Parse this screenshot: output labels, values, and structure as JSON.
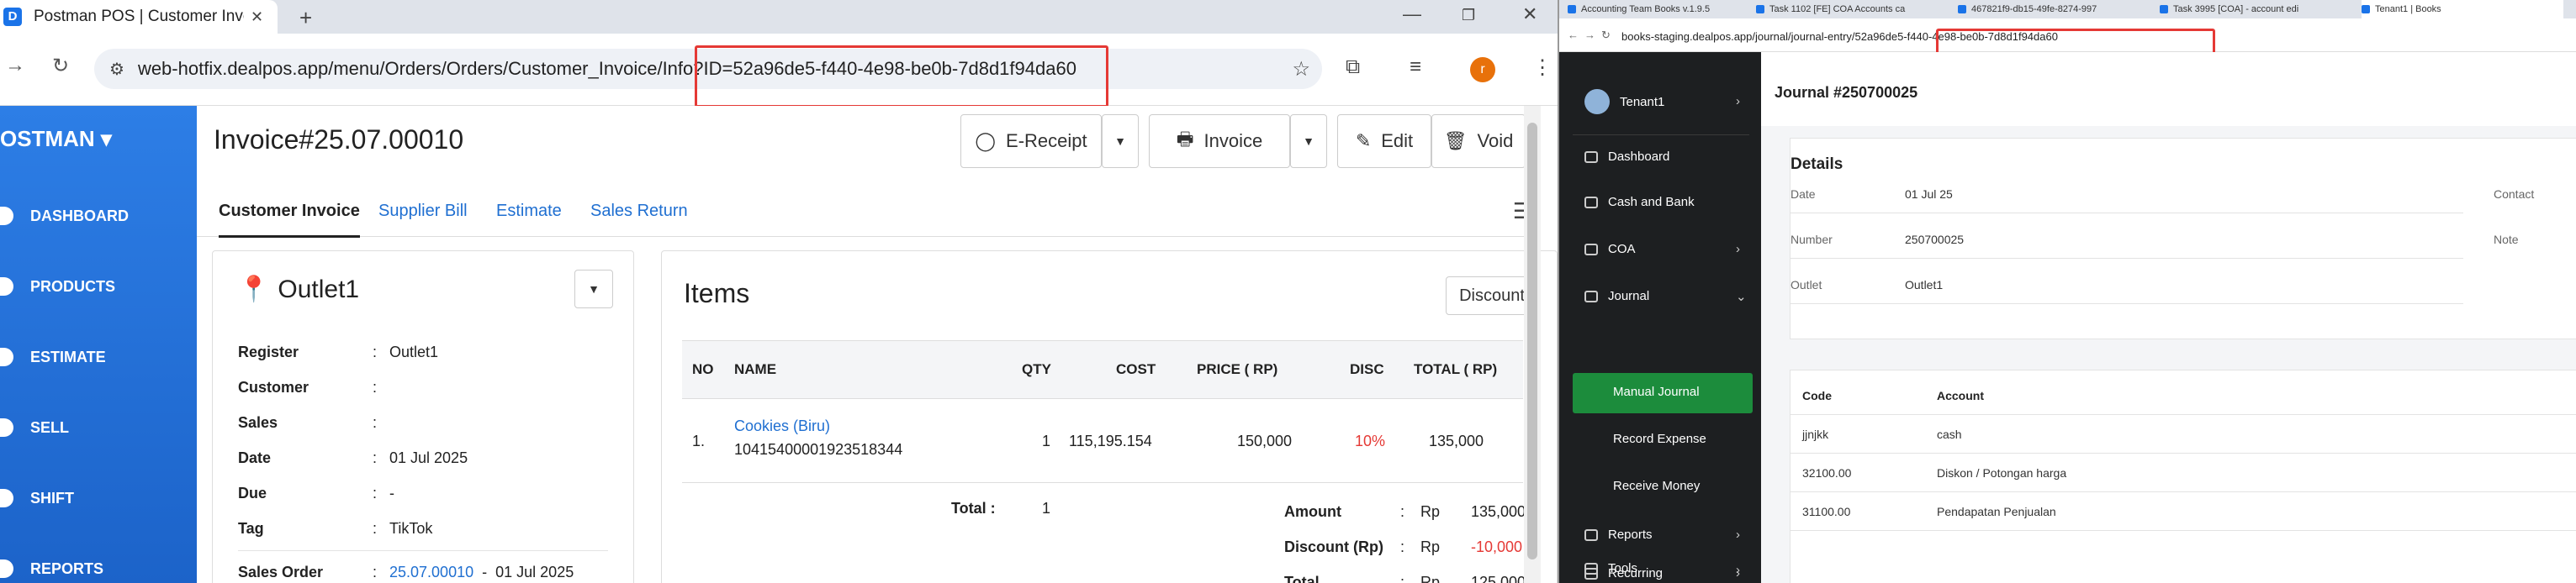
{
  "left_browser": {
    "tab_title": "Postman POS | Customer Invoic",
    "url": "web-hotfix.dealpos.app/menu/Orders/Orders/Customer_Invoice/Info?ID=52a96de5-f440-4e98-be0b-7d8d1f94da60",
    "profile_initial": "r"
  },
  "app": {
    "brand": "OSTMAN",
    "sidebar": [
      "DASHBOARD",
      "PRODUCTS",
      "ESTIMATE",
      "SELL",
      "SHIFT",
      "REPORTS"
    ],
    "invoice_title": "Invoice#25.07.00010",
    "buttons": {
      "ereceipt": "E-Receipt",
      "invoice": "Invoice",
      "edit": "Edit",
      "void": "Void"
    },
    "tabs": [
      "Customer Invoice",
      "Supplier Bill",
      "Estimate",
      "Sales Return"
    ],
    "outlet": {
      "title": "Outlet1",
      "fields": [
        {
          "label": "Register",
          "value": "Outlet1"
        },
        {
          "label": "Customer",
          "value": ""
        },
        {
          "label": "Sales",
          "value": ""
        },
        {
          "label": "Date",
          "value": "01 Jul 2025"
        },
        {
          "label": "Due",
          "value": "-"
        },
        {
          "label": "Tag",
          "value": "TikTok"
        }
      ],
      "sales_order": {
        "label": "Sales Order",
        "number": "25.07.00010",
        "sep": "-",
        "date": "01 Jul 2025"
      }
    },
    "items": {
      "title": "Items",
      "discount_button": "Discount",
      "columns": [
        "NO",
        "NAME",
        "QTY",
        "COST",
        "PRICE ( RP)",
        "DISC",
        "TOTAL ( RP)"
      ],
      "rows": [
        {
          "no": "1.",
          "name": "Cookies (Biru)",
          "code": "10415400001923518344",
          "qty": "1",
          "cost": "115,195.154",
          "price": "150,000",
          "disc": "10%",
          "total": "135,000"
        }
      ],
      "total_label": "Total :",
      "total_qty": "1",
      "summary": [
        {
          "label": "Amount",
          "colon": ":",
          "cur": "Rp",
          "value": "135,000"
        },
        {
          "label": "Discount (Rp)",
          "colon": ":",
          "cur": "Rp",
          "value": "-10,000"
        },
        {
          "label": "Total",
          "colon": ":",
          "cur": "Rp",
          "value": "125,000"
        }
      ]
    }
  },
  "right_browser": {
    "tabs": [
      "Accounting Team Books v.1.9.5",
      "Task 1102 [FE] COA Accounts ca",
      "467821f9-db15-49fe-8274-997",
      "Task 3995 [COA] - account edi",
      "Tenant1 | Books"
    ],
    "url": "books-staging.dealpos.app/journal/journal-entry/52a96de5-f440-4e98-be0b-7d8d1f94da60"
  },
  "books": {
    "tenant": "Tenant1",
    "menu": [
      "Dashboard",
      "Cash and Bank",
      "COA",
      "Journal",
      "Manual Journal",
      "Record Expense",
      "Receive Money",
      "Reports",
      "Recurring",
      "Tools"
    ],
    "journal_title": "Journal #250700025",
    "details_title": "Details",
    "details": [
      {
        "label": "Date",
        "value": "01 Jul 25"
      },
      {
        "label": "Number",
        "value": "250700025"
      },
      {
        "label": "Outlet",
        "value": "Outlet1"
      }
    ],
    "details_right": [
      "Contact",
      "Note"
    ],
    "table_columns": [
      "Code",
      "Account"
    ],
    "table_rows": [
      {
        "code": "jjnjkk",
        "account": "cash"
      },
      {
        "code": "32100.00",
        "account": "Diskon / Potongan harga"
      },
      {
        "code": "31100.00",
        "account": "Pendapatan Penjualan"
      }
    ]
  }
}
